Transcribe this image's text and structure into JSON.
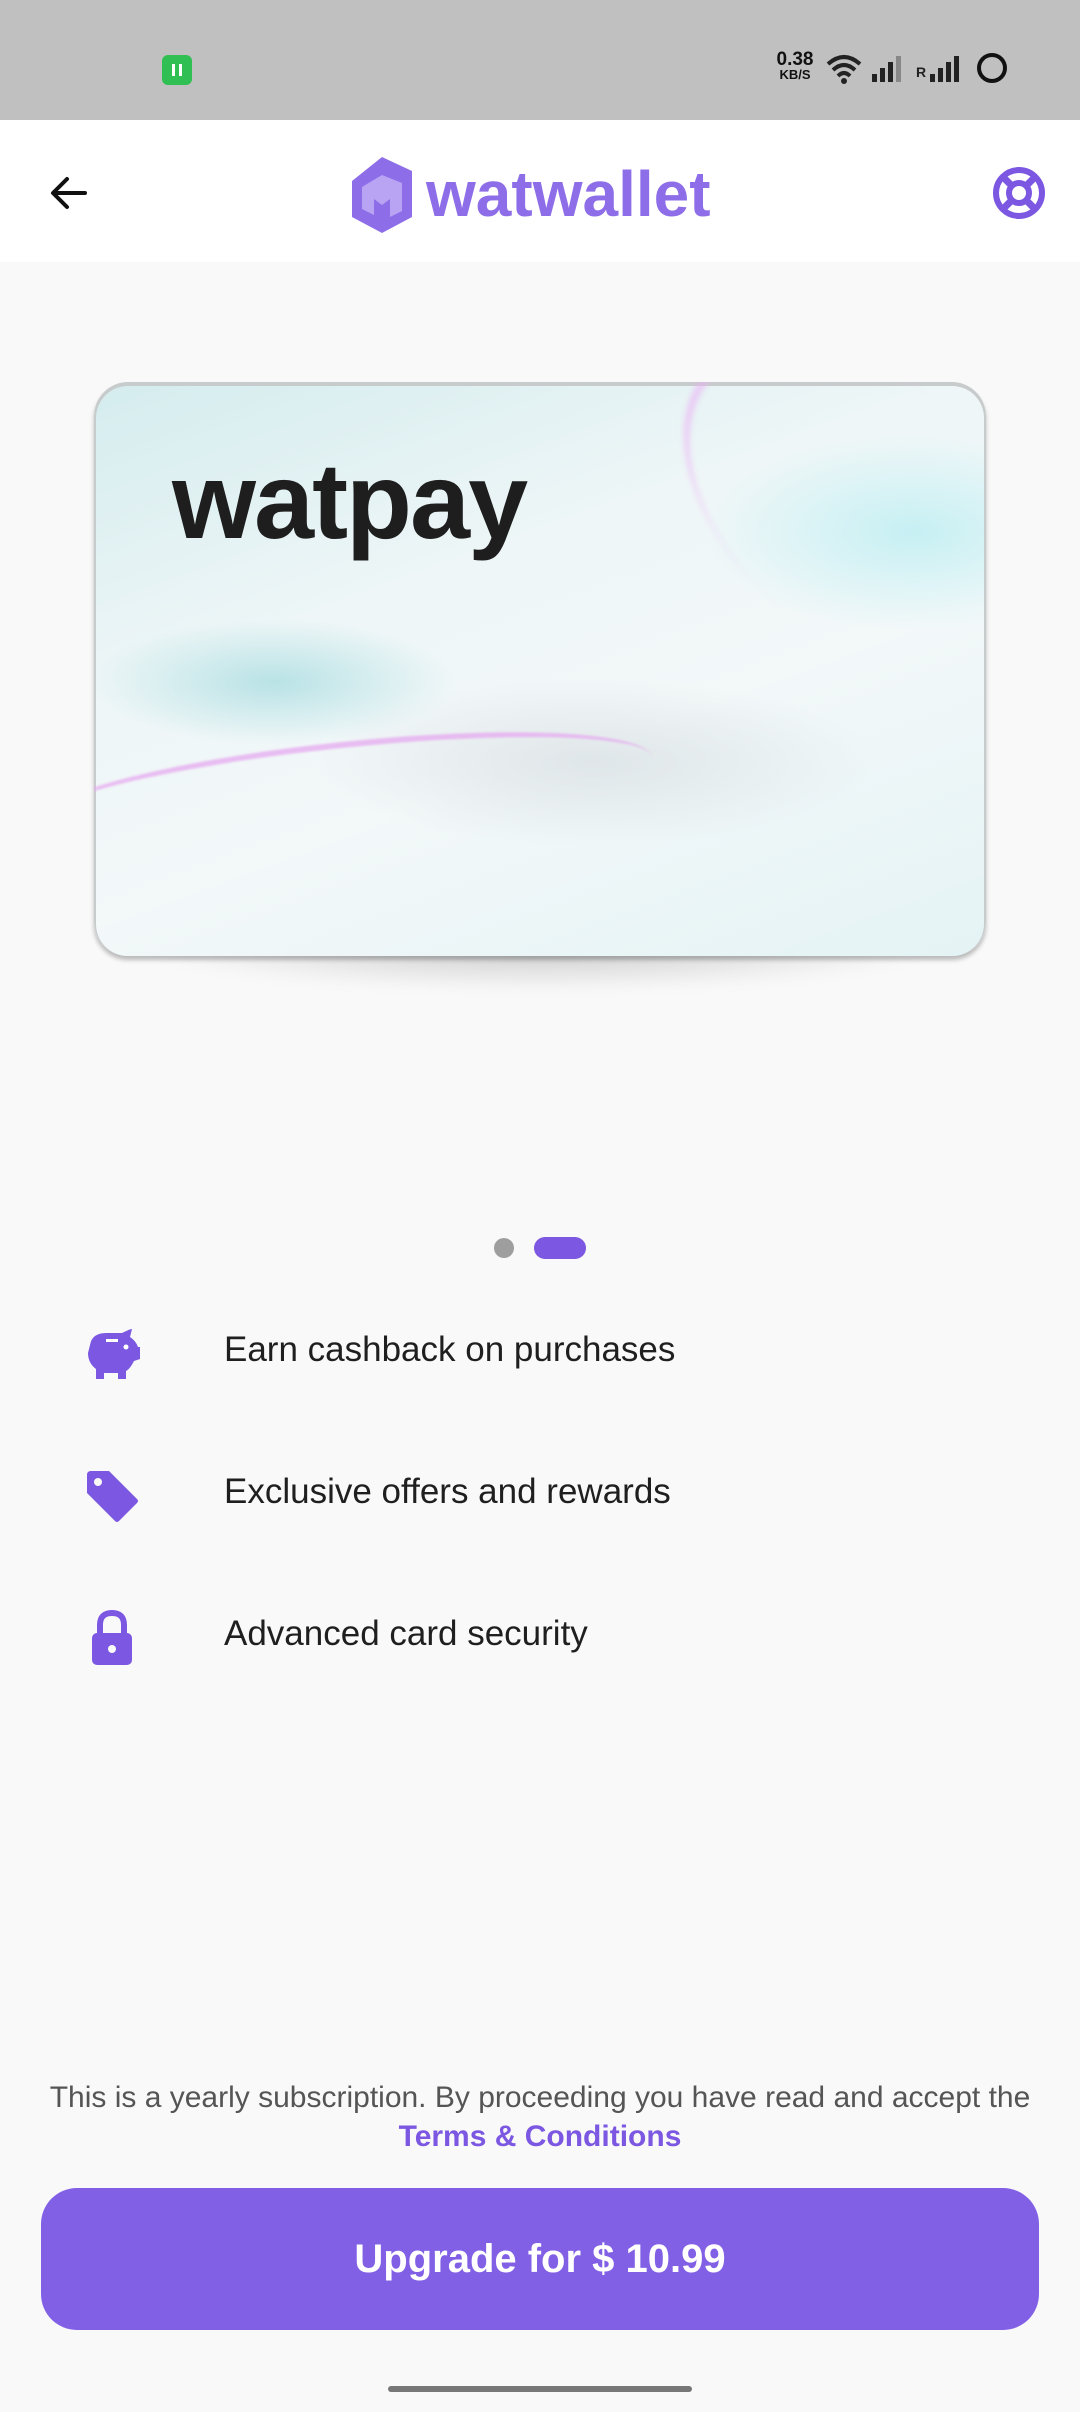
{
  "status_bar": {
    "net_speed_value": "0.38",
    "net_speed_unit": "KB/S",
    "roaming_label": "R"
  },
  "header": {
    "brand": "watwallet"
  },
  "card": {
    "brand": "watpay"
  },
  "carousel": {
    "page_count": 2,
    "active_index": 1
  },
  "features": [
    {
      "icon": "piggy-bank-icon",
      "label": "Earn cashback on purchases"
    },
    {
      "icon": "tag-icon",
      "label": "Exclusive offers and rewards"
    },
    {
      "icon": "lock-icon",
      "label": "Advanced card security"
    }
  ],
  "footer": {
    "terms_text": "This is a yearly subscription. By proceeding you have read and accept the",
    "terms_link": "Terms & Conditions",
    "upgrade_label": "Upgrade for $ 10.99"
  },
  "colors": {
    "accent": "#8160e6",
    "status_bar_bg": "#c0c0c0",
    "page_bg": "#f9f9f9"
  }
}
